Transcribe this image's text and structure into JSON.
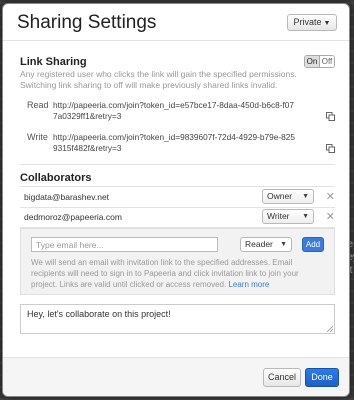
{
  "dialog": {
    "title": "Sharing Settings",
    "privacy_button": "Private"
  },
  "link_sharing": {
    "title": "Link Sharing",
    "toggle_on": "On",
    "toggle_off": "Off",
    "toggle_state": "On",
    "description": "Any registered user who clicks the link will gain the specified permissions. Switching link sharing to off will make previously shared links invalid.",
    "links": [
      {
        "label": "Read",
        "url": "http://papeeria.com/join?token_id=e57bce17-8daa-450d-b6c8-f077a0329ff1&retry=3"
      },
      {
        "label": "Write",
        "url": "http://papeeria.com/join?token_id=9839607f-72d4-4929-b79e-8259315f482f&retry=3"
      }
    ]
  },
  "collaborators": {
    "title": "Collaborators",
    "list": [
      {
        "email": "bigdata@barashev.net",
        "role": "Owner"
      },
      {
        "email": "dedmoroz@papeeria.com",
        "role": "Writer"
      }
    ],
    "invite": {
      "placeholder": "Type email here...",
      "role": "Reader",
      "add_label": "Add",
      "note": "We will send an email with invitation link to the specified addresses. Email recipients will need to sign in to Papeeria and click invitation link to join your project. Links are valid until clicked or access removed.",
      "learn_more": "Learn more"
    },
    "message": "Hey, let's collaborate on this project!"
  },
  "footer": {
    "cancel_label": "Cancel",
    "done_label": "Done"
  },
  "colors": {
    "accent": "#3b7be0",
    "done_button": "#1f5fc9"
  }
}
